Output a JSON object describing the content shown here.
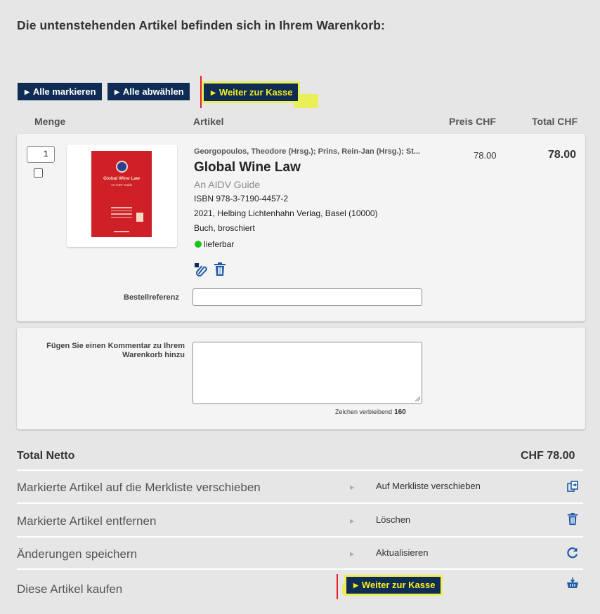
{
  "heading": "Die untenstehenden Artikel befinden sich in Ihrem Warenkorb:",
  "toolbar": {
    "select_all": "Alle markieren",
    "deselect_all": "Alle abwählen",
    "checkout": "Weiter zur Kasse"
  },
  "columns": {
    "quantity": "Menge",
    "article": "Artikel",
    "price": "Preis CHF",
    "total": "Total CHF"
  },
  "item": {
    "quantity": "1",
    "authors": "Georgopoulos, Theodore (Hrsg.); Prins, Rein-Jan (Hrsg.); St...",
    "title": "Global Wine Law",
    "subtitle": "An AIDV Guide",
    "isbn": "ISBN 978-3-7190-4457-2",
    "publisher": "2021, Helbing Lichtenhahn Verlag, Basel (10000)",
    "binding": "Buch, broschiert",
    "availability": "lieferbar",
    "price": "78.00",
    "total": "78.00",
    "cover_title": "Global Wine Law",
    "cover_subtitle": "An AIDV Guide"
  },
  "order_reference": {
    "label": "Bestellreferenz",
    "value": ""
  },
  "comment": {
    "label": "Fügen Sie einen Kommentar zu Ihrem Warenkorb hinzu",
    "value": "",
    "remaining_label": "Zeichen verbleibend",
    "remaining_count": "160"
  },
  "summary": {
    "total_label": "Total Netto",
    "total_value": "CHF 78.00"
  },
  "actions": [
    {
      "label": "Markierte Artikel auf die Merkliste verschieben",
      "action": "Auf Merkliste verschieben",
      "icon": "move-to-wishlist-icon"
    },
    {
      "label": "Markierte Artikel entfernen",
      "action": "Löschen",
      "icon": "trash-icon"
    },
    {
      "label": "Änderungen speichern",
      "action": "Aktualisieren",
      "icon": "refresh-icon"
    },
    {
      "label": "Diese Artikel kaufen",
      "action": "Weiter zur Kasse",
      "icon": "basket-icon"
    }
  ],
  "colors": {
    "button_bg": "#0f2d54",
    "checkout_text": "#f7ef1c",
    "highlight": "#e9f03d",
    "icon_blue": "#1e5aa6",
    "available_green": "#19c61d",
    "cover_red": "#cf2028"
  }
}
